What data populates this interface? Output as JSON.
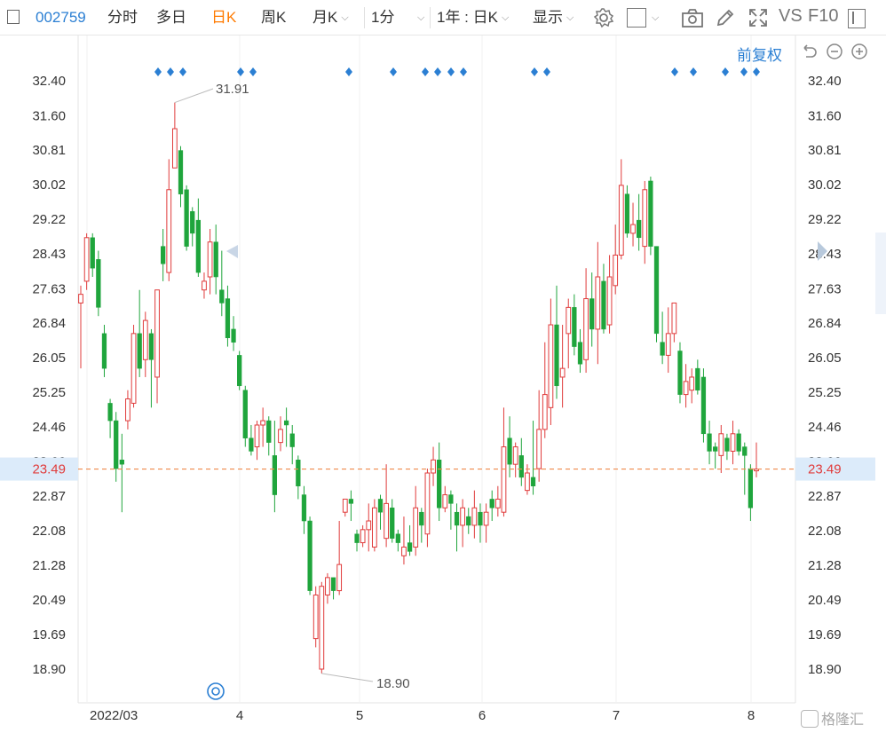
{
  "toolbar": {
    "code": "002759",
    "tabs": [
      "分时",
      "多日",
      "日K",
      "周K",
      "月K"
    ],
    "active_tab": "日K",
    "period": "1分",
    "range": "1年 : 日K",
    "display": "显示",
    "compare": "VS",
    "f10": "F10"
  },
  "adjust_label": "前复权",
  "current_price_label": "23.49",
  "watermark": "格隆汇",
  "colors": {
    "up": "#e03b3b",
    "down": "#1fa53c",
    "accent": "#2b7fd3",
    "dashed": "#f08a4b"
  },
  "chart_data": {
    "type": "candlestick",
    "y_ticks": [
      "32.40",
      "31.60",
      "30.81",
      "30.02",
      "29.22",
      "28.43",
      "27.63",
      "26.84",
      "26.05",
      "25.25",
      "24.46",
      "23.66",
      "22.87",
      "22.08",
      "21.28",
      "20.49",
      "19.69",
      "18.90"
    ],
    "ylim": [
      18.9,
      32.4
    ],
    "x_ticks": [
      "2022/03",
      "4",
      "5",
      "6",
      "7",
      "8"
    ],
    "annotations": [
      {
        "text": "31.91",
        "label": "high"
      },
      {
        "text": "18.90",
        "label": "low"
      }
    ],
    "current_price": 23.49,
    "candles": [
      [
        27.3,
        27.5,
        25.8,
        27.7
      ],
      [
        27.8,
        28.8,
        27.6,
        28.9
      ],
      [
        28.8,
        28.1,
        27.9,
        28.9
      ],
      [
        28.3,
        27.2,
        27.0,
        28.5
      ],
      [
        26.6,
        25.8,
        25.6,
        26.8
      ],
      [
        25.0,
        24.6,
        24.2,
        25.1
      ],
      [
        24.6,
        23.5,
        23.2,
        24.8
      ],
      [
        23.7,
        23.6,
        22.5,
        24.3
      ],
      [
        24.6,
        25.1,
        24.4,
        25.3
      ],
      [
        25.0,
        26.6,
        24.9,
        26.8
      ],
      [
        26.6,
        25.8,
        25.6,
        27.6
      ],
      [
        26.0,
        26.9,
        25.6,
        27.1
      ],
      [
        26.6,
        26.0,
        24.9,
        26.7
      ],
      [
        25.6,
        27.6,
        25.0,
        27.6
      ],
      [
        28.6,
        28.2,
        27.8,
        29.0
      ],
      [
        28.0,
        29.9,
        27.8,
        30.6
      ],
      [
        30.4,
        31.3,
        30.4,
        31.9
      ],
      [
        30.8,
        29.8,
        29.5,
        30.9
      ],
      [
        29.9,
        28.6,
        28.5,
        30.0
      ],
      [
        29.4,
        28.9,
        28.6,
        29.5
      ],
      [
        29.2,
        28.0,
        27.9,
        29.7
      ],
      [
        27.6,
        27.8,
        27.4,
        28.0
      ],
      [
        27.9,
        28.7,
        27.5,
        29.0
      ],
      [
        28.7,
        27.9,
        27.5,
        29.1
      ],
      [
        27.6,
        27.3,
        27.0,
        28.5
      ],
      [
        27.4,
        26.5,
        26.3,
        27.7
      ],
      [
        26.7,
        26.4,
        26.2,
        27.0
      ],
      [
        26.1,
        25.4,
        25.3,
        26.2
      ],
      [
        25.3,
        24.2,
        24.0,
        25.4
      ],
      [
        24.2,
        23.9,
        23.8,
        24.5
      ],
      [
        24.0,
        24.5,
        23.7,
        24.6
      ],
      [
        24.5,
        24.6,
        24.0,
        24.9
      ],
      [
        24.6,
        24.1,
        23.8,
        24.7
      ],
      [
        23.8,
        22.9,
        22.5,
        24.6
      ],
      [
        24.1,
        24.4,
        23.9,
        24.7
      ],
      [
        24.6,
        24.5,
        24.0,
        24.9
      ],
      [
        24.3,
        24.0,
        23.6,
        24.5
      ],
      [
        23.7,
        23.1,
        22.8,
        23.8
      ],
      [
        22.9,
        22.3,
        22.0,
        23.1
      ],
      [
        22.3,
        20.7,
        20.6,
        22.4
      ],
      [
        19.6,
        20.6,
        19.4,
        20.8
      ],
      [
        18.9,
        20.8,
        18.8,
        20.9
      ],
      [
        20.6,
        21.0,
        20.4,
        21.1
      ],
      [
        21.0,
        20.7,
        20.5,
        21.0
      ],
      [
        20.7,
        21.3,
        20.6,
        22.3
      ],
      [
        22.5,
        22.8,
        22.4,
        22.8
      ],
      [
        22.8,
        22.7,
        22.3,
        23.0
      ],
      [
        22.0,
        21.8,
        21.6,
        22.1
      ],
      [
        21.8,
        22.1,
        21.7,
        22.2
      ],
      [
        22.1,
        22.3,
        21.6,
        22.7
      ],
      [
        21.7,
        22.6,
        21.6,
        22.8
      ],
      [
        22.8,
        22.5,
        22.1,
        22.9
      ],
      [
        21.9,
        22.7,
        21.7,
        23.6
      ],
      [
        22.6,
        21.9,
        21.8,
        22.8
      ],
      [
        22.0,
        21.8,
        21.6,
        22.1
      ],
      [
        21.5,
        21.7,
        21.3,
        22.4
      ],
      [
        21.8,
        21.6,
        21.5,
        22.2
      ],
      [
        21.7,
        22.6,
        21.5,
        23.1
      ],
      [
        22.5,
        22.2,
        21.8,
        22.6
      ],
      [
        22.0,
        23.4,
        21.7,
        23.5
      ],
      [
        23.4,
        23.7,
        23.1,
        24.0
      ],
      [
        23.7,
        22.6,
        22.3,
        24.1
      ],
      [
        22.6,
        22.9,
        22.5,
        23.1
      ],
      [
        22.9,
        22.7,
        22.1,
        23.0
      ],
      [
        22.5,
        22.2,
        21.6,
        22.7
      ],
      [
        22.2,
        22.6,
        21.7,
        22.8
      ],
      [
        22.4,
        22.2,
        22.0,
        22.6
      ],
      [
        22.2,
        22.6,
        21.9,
        23.0
      ],
      [
        22.5,
        22.2,
        21.8,
        22.7
      ],
      [
        22.2,
        22.5,
        21.8,
        22.7
      ],
      [
        22.8,
        22.6,
        22.3,
        23.0
      ],
      [
        22.6,
        22.8,
        22.4,
        23.1
      ],
      [
        22.5,
        24.0,
        22.4,
        24.9
      ],
      [
        24.2,
        23.6,
        23.3,
        24.7
      ],
      [
        23.6,
        24.0,
        23.3,
        24.1
      ],
      [
        23.8,
        23.3,
        23.1,
        24.2
      ],
      [
        23.0,
        23.4,
        22.9,
        23.6
      ],
      [
        23.3,
        23.1,
        22.9,
        24.6
      ],
      [
        23.5,
        24.4,
        23.2,
        25.3
      ],
      [
        24.4,
        25.2,
        24.2,
        26.4
      ],
      [
        24.9,
        26.8,
        24.5,
        27.4
      ],
      [
        26.8,
        25.4,
        25.1,
        27.7
      ],
      [
        25.6,
        25.8,
        24.9,
        26.8
      ],
      [
        26.6,
        27.2,
        25.8,
        27.4
      ],
      [
        27.2,
        26.3,
        26.1,
        27.5
      ],
      [
        26.4,
        25.9,
        25.7,
        26.7
      ],
      [
        26.0,
        27.4,
        25.7,
        28.1
      ],
      [
        27.4,
        26.7,
        26.3,
        28.0
      ],
      [
        26.7,
        27.9,
        25.9,
        28.7
      ],
      [
        27.8,
        26.7,
        26.6,
        28.2
      ],
      [
        26.8,
        27.9,
        26.6,
        28.4
      ],
      [
        27.7,
        28.4,
        27.5,
        29.1
      ],
      [
        28.4,
        30.0,
        28.3,
        30.6
      ],
      [
        29.8,
        28.9,
        28.8,
        30.0
      ],
      [
        28.9,
        29.1,
        28.6,
        29.6
      ],
      [
        29.2,
        28.8,
        28.5,
        29.8
      ],
      [
        28.6,
        29.9,
        28.2,
        30.1
      ],
      [
        30.1,
        28.6,
        28.4,
        30.2
      ],
      [
        28.6,
        26.6,
        26.4,
        28.6
      ],
      [
        26.4,
        26.1,
        25.9,
        27.1
      ],
      [
        26.1,
        26.6,
        25.7,
        27.2
      ],
      [
        26.6,
        27.3,
        26.4,
        27.3
      ],
      [
        26.2,
        25.2,
        25.0,
        26.4
      ],
      [
        25.2,
        25.5,
        24.9,
        25.9
      ],
      [
        25.3,
        25.6,
        25.0,
        25.8
      ],
      [
        25.8,
        25.3,
        25.2,
        26.0
      ],
      [
        25.6,
        24.3,
        24.1,
        25.8
      ],
      [
        24.3,
        23.9,
        23.6,
        24.6
      ],
      [
        24.0,
        23.9,
        23.5,
        24.1
      ],
      [
        23.8,
        24.3,
        23.4,
        24.5
      ],
      [
        24.2,
        23.9,
        23.7,
        24.3
      ],
      [
        23.9,
        24.3,
        23.6,
        24.6
      ],
      [
        24.3,
        23.9,
        23.8,
        24.4
      ],
      [
        24.0,
        23.8,
        22.9,
        24.1
      ],
      [
        23.5,
        22.6,
        22.3,
        23.6
      ],
      [
        23.45,
        23.49,
        23.3,
        24.1
      ]
    ]
  }
}
